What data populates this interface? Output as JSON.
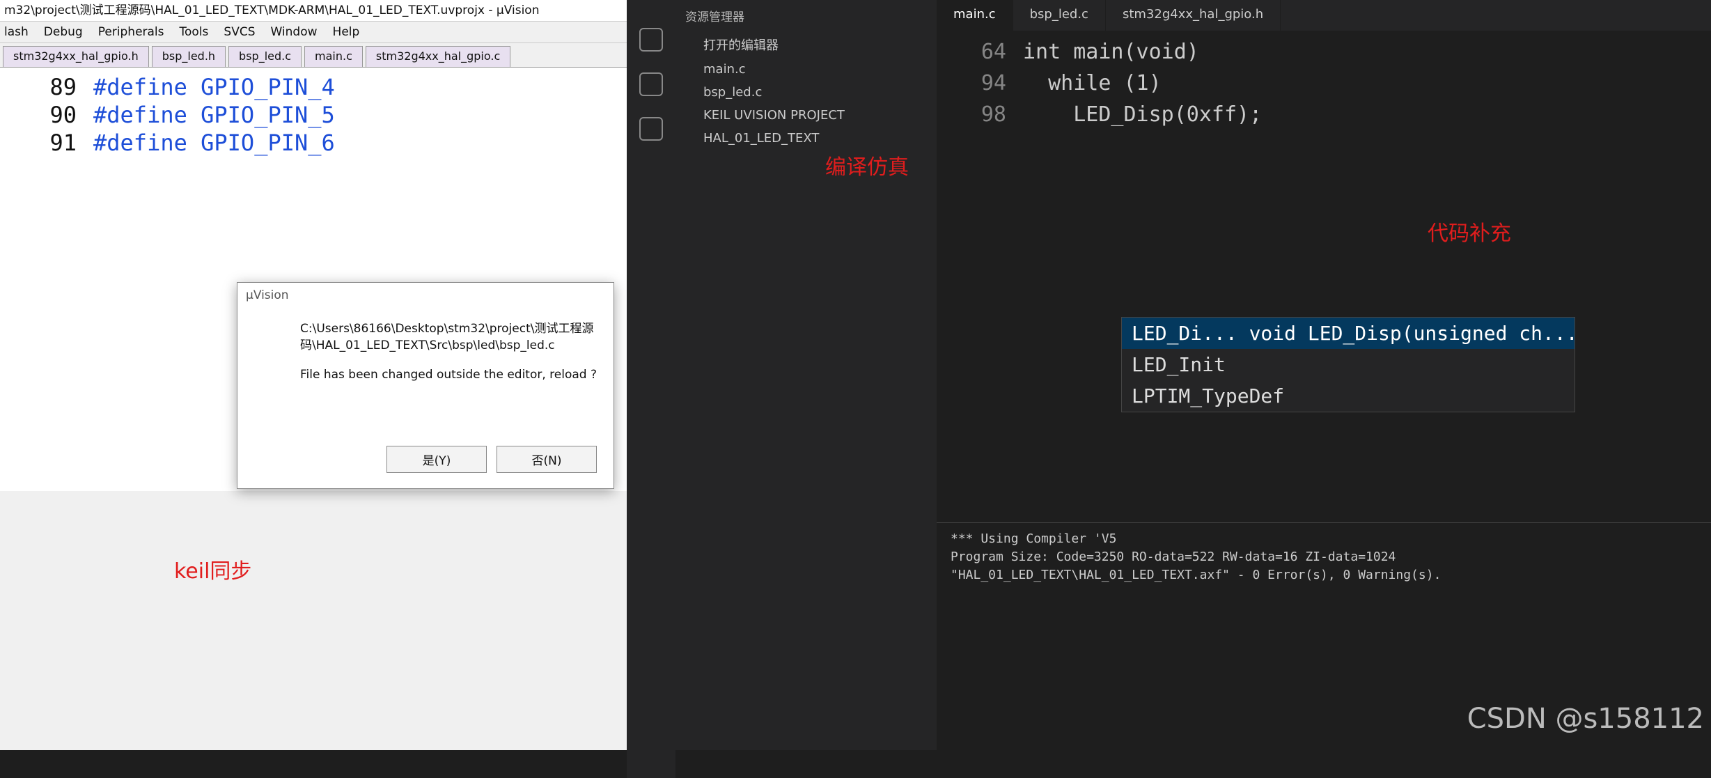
{
  "keil": {
    "title": "m32\\project\\测试工程源码\\HAL_01_LED_TEXT\\MDK-ARM\\HAL_01_LED_TEXT.uvprojx - µVision",
    "menu": [
      "lash",
      "Debug",
      "Peripherals",
      "Tools",
      "SVCS",
      "Window",
      "Help"
    ],
    "tabs": [
      "stm32g4xx_hal_gpio.h",
      "bsp_led.h",
      "bsp_led.c",
      "main.c",
      "stm32g4xx_hal_gpio.c"
    ],
    "code": [
      {
        "ln": "89",
        "text": "#define GPIO_PIN_4"
      },
      {
        "ln": "90",
        "text": "#define GPIO_PIN_5"
      },
      {
        "ln": "91",
        "text": "#define GPIO_PIN_6"
      }
    ]
  },
  "dialog": {
    "title": "µVision",
    "path": "C:\\Users\\86166\\Desktop\\stm32\\project\\测试工程源码\\HAL_01_LED_TEXT\\Src\\bsp\\led\\bsp_led.c",
    "question": "File has been changed outside the editor, reload ?",
    "yes": "是(Y)",
    "no": "否(N)"
  },
  "vscode": {
    "explorer_title": "资源管理器",
    "explorer_items": [
      "打开的编辑器",
      "main.c",
      "bsp_led.c",
      "KEIL UVISION PROJECT",
      "HAL_01_LED_TEXT"
    ],
    "tabs": [
      "main.c",
      "bsp_led.c",
      "stm32g4xx_hal_gpio.h"
    ],
    "code": [
      {
        "ln": "64",
        "text": "int main(void)"
      },
      {
        "ln": "94",
        "text": "  while (1)"
      },
      {
        "ln": "98",
        "text": "    LED_Disp(0xff);"
      }
    ],
    "suggestions": [
      "LED_Di...   void LED_Disp(unsigned ch...",
      "LED_Init",
      "LPTIM_TypeDef"
    ],
    "output": [
      "*** Using Compiler 'V5",
      "Program Size: Code=3250 RO-data=522 RW-data=16 ZI-data=1024",
      "\"HAL_01_LED_TEXT\\HAL_01_LED_TEXT.axf\" - 0 Error(s), 0 Warning(s)."
    ]
  },
  "annotations": {
    "compile": "编译仿真",
    "complete": "代码补充",
    "sync": "keil同步"
  },
  "watermark": "CSDN @s158112"
}
